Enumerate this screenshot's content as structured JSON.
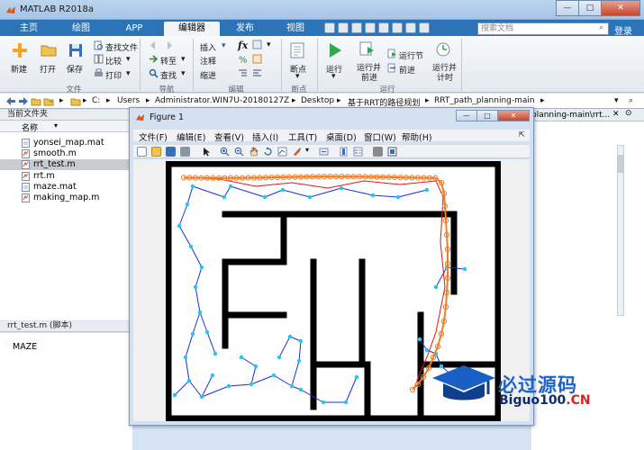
{
  "app": {
    "title": "MATLAB R2018a"
  },
  "tabs": [
    "主页",
    "绘图",
    "APP",
    "编辑器",
    "发布",
    "视图"
  ],
  "search": {
    "placeholder": "搜索文档"
  },
  "login_label": "登录",
  "ribbon": {
    "file": {
      "new": "新建",
      "open": "打开",
      "save": "保存",
      "find_files": "查找文件",
      "compare": "比较",
      "print": "打印",
      "group": "文件"
    },
    "nav": {
      "goto": "转至",
      "find": "查找",
      "group": "导航"
    },
    "edit": {
      "insert": "插入",
      "comment": "注释",
      "indent": "缩进",
      "fx": "fx",
      "group": "编辑"
    },
    "breakpoints": {
      "label": "断点",
      "group": "断点"
    },
    "run": {
      "run": "运行",
      "run_advance_1": "运行并",
      "run_advance_2": "前进",
      "run_section": "运行节",
      "advance": "前进",
      "run_time_1": "运行并",
      "run_time_2": "计时",
      "group": "运行"
    }
  },
  "address": {
    "parts": [
      "C:",
      "Users",
      "Administrator.WIN7U-20180127Z",
      "Desktop",
      "基于RRT的路径规划",
      "RRT_path_planning-main"
    ]
  },
  "current_folder": {
    "title": "当前文件夹",
    "column": "名称",
    "files": [
      "yonsei_map.mat",
      "smooth.m",
      "rrt_test.m",
      "rrt.m",
      "maze.mat",
      "making_map.m"
    ],
    "selected": 2
  },
  "details": {
    "title": "rrt_test.m  (脚本)",
    "content": "MAZE"
  },
  "right_panel": {
    "path": "planning-main\\rrt..."
  },
  "figure": {
    "title": "Figure 1",
    "menu": [
      "文件(F)",
      "编辑(E)",
      "查看(V)",
      "插入(I)",
      "工具(T)",
      "桌面(D)",
      "窗口(W)",
      "帮助(H)"
    ]
  },
  "watermark": {
    "text1": "必过源码",
    "text2a": "Biguo100",
    "text2b": ".CN"
  },
  "colors": {
    "tab_bar": "#2c74b8",
    "tree_edge": "#1d2fd8",
    "tree_node": "#1ec9ee",
    "path_red": "#e01818",
    "smooth_path": "#f47c20",
    "obstacle": "#000000"
  }
}
